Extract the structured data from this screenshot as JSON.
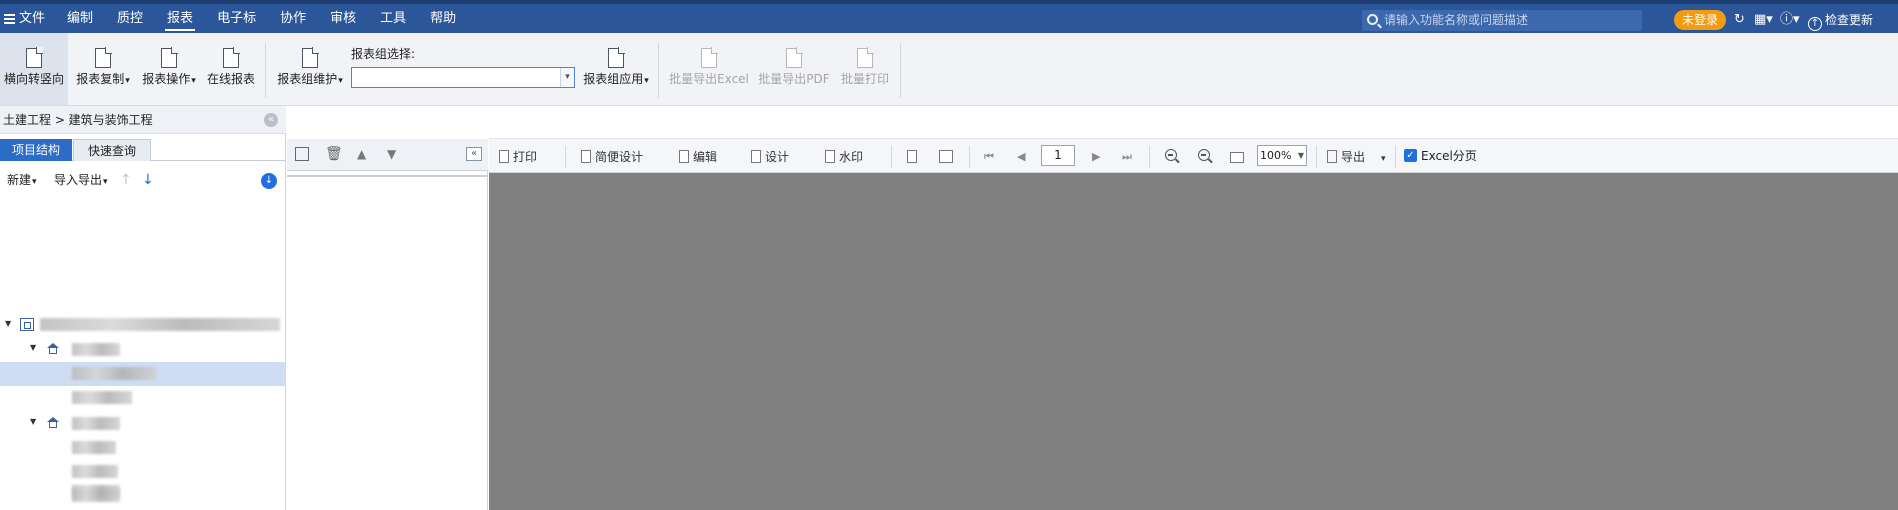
{
  "menu": {
    "items": [
      "文件",
      "编制",
      "质控",
      "报表",
      "电子标",
      "协作",
      "审核",
      "工具",
      "帮助"
    ],
    "active": "报表",
    "search_placeholder": "请输入功能名称或问题描述",
    "login_label": "未登录",
    "update_label": "检查更新"
  },
  "ribbon": {
    "buttons": {
      "rotate": "横向转竖向",
      "copy": "报表复制",
      "operate": "报表操作",
      "online": "在线报表",
      "group_maintain": "报表组维护",
      "group_apply": "报表组应用",
      "export_excel": "批量导出Excel",
      "export_pdf": "批量导出PDF",
      "batch_print": "批量打印"
    },
    "group_select_label": "报表组选择:",
    "group_select_value": ""
  },
  "left_panel": {
    "breadcrumb": "土建工程 > 建筑与装饰工程",
    "tabs": [
      "项目结构",
      "快速查询"
    ],
    "active_tab": "项目结构",
    "toolbar": {
      "new": "新建",
      "import_export": "导入导出"
    }
  },
  "preview_toolbar": {
    "print": "打印",
    "simple_design": "简便设计",
    "edit": "编辑",
    "design": "设计",
    "watermark": "水印",
    "page": "1",
    "zoom": "100%",
    "export": "导出",
    "excel_paging": "Excel分页",
    "excel_paging_checked": true
  },
  "colors": {
    "menubar": "#2b579a",
    "accent": "#2b6cc7",
    "login_badge": "#f39c12",
    "canvas": "#808080"
  },
  "icons": [
    "hamburger-icon",
    "search-icon",
    "refresh-icon",
    "grid-icon",
    "info-icon",
    "upload-icon",
    "document-icon",
    "building-icon",
    "house-icon",
    "printer-icon",
    "zoom-in-icon",
    "zoom-out-icon"
  ]
}
